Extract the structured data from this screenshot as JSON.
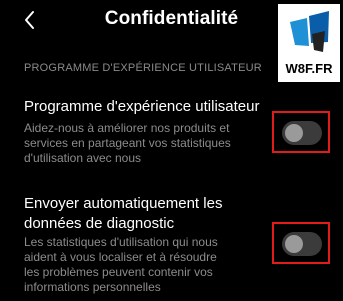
{
  "header": {
    "title": "Confidentialité"
  },
  "watermark": {
    "brand": "W8F.FR"
  },
  "section": {
    "header": "PROGRAMME D'EXPÉRIENCE UTILISATEUR"
  },
  "items": [
    {
      "title": "Programme d'expérience utilisateur",
      "desc_lines": [
        "Aidez-nous à améliorer nos produits et",
        "services en partageant vos statistiques",
        "d'utilisation avec nous"
      ],
      "enabled": false
    },
    {
      "title_lines": [
        "Envoyer automatiquement les",
        "données de diagnostic"
      ],
      "desc_lines": [
        "Les statistiques d'utilisation qui nous",
        "aident à vous localiser et à résoudre",
        "les problèmes peuvent contenir vos",
        "informations personnelles"
      ],
      "enabled": false
    }
  ],
  "colors": {
    "highlight": "#e21b1b",
    "toggle_off": "#3b3b3b",
    "secondary_text": "#8c8c8c"
  }
}
